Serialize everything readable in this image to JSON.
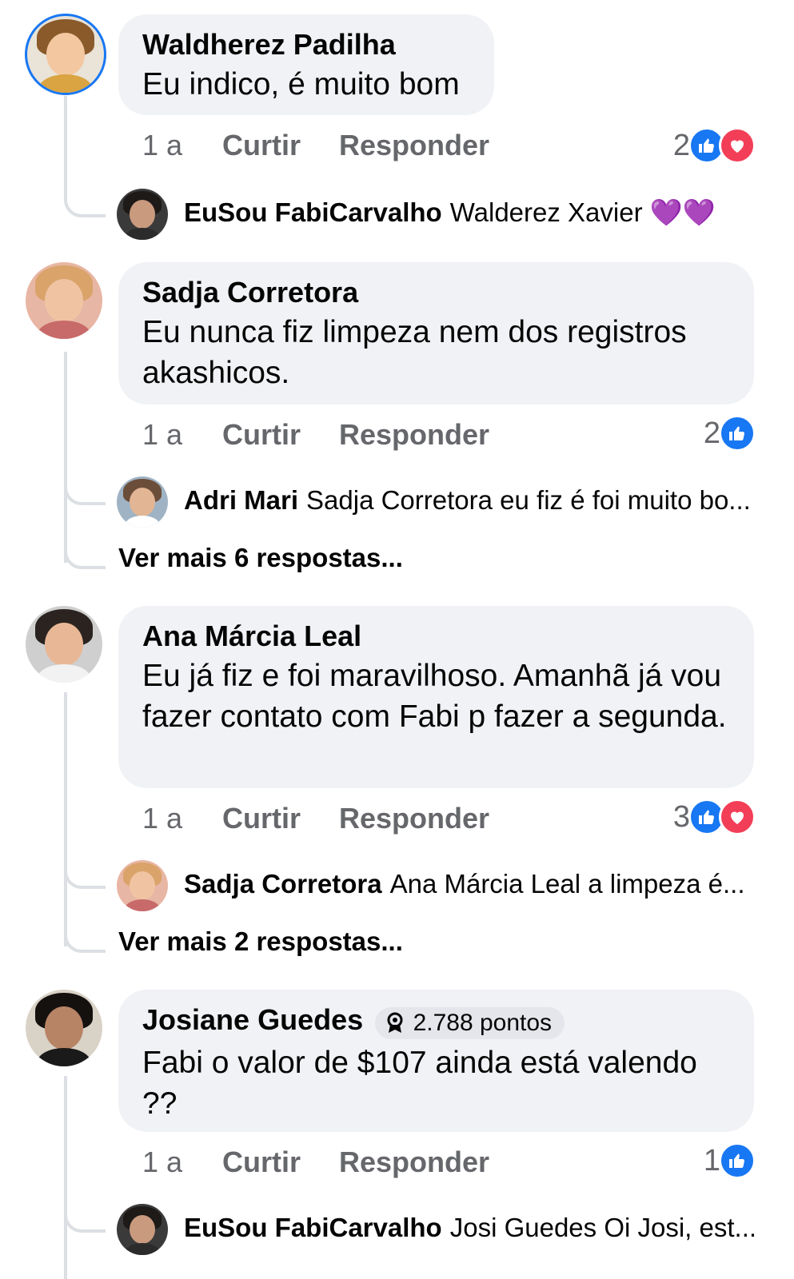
{
  "comments": [
    {
      "name": "Waldherez Padilha",
      "text": "Eu indico, é muito bom",
      "time": "1 a",
      "like_label": "Curtir",
      "reply_label": "Responder",
      "reaction_count": "2",
      "reactions": [
        "like-icon",
        "love-icon"
      ],
      "reply": {
        "name": "EuSou FabiCarvalho",
        "text": "Walderez Xavier 💜💜"
      }
    },
    {
      "name": "Sadja Corretora",
      "text": "Eu nunca fiz limpeza nem dos registros akashicos.",
      "time": "1 a",
      "like_label": "Curtir",
      "reply_label": "Responder",
      "reaction_count": "2",
      "reactions": [
        "like-icon"
      ],
      "reply": {
        "name": "Adri Mari",
        "text": "Sadja Corretora eu fiz é foi muito bo..."
      },
      "more_replies": "Ver mais 6 respostas..."
    },
    {
      "name": "Ana Márcia Leal",
      "text": "Eu já fiz e foi maravilhoso. Amanhã já vou fazer contato com Fabi p fazer a segunda.",
      "time": "1 a",
      "like_label": "Curtir",
      "reply_label": "Responder",
      "reaction_count": "3",
      "reactions": [
        "like-icon",
        "love-icon"
      ],
      "reply": {
        "name": "Sadja Corretora",
        "text": "Ana Márcia Leal  a limpeza é..."
      },
      "more_replies": "Ver mais 2 respostas..."
    },
    {
      "name": "Josiane Guedes",
      "badge": "2.788 pontos",
      "text": "Fabi o valor de $107 ainda está valendo ??",
      "time": "1 a",
      "like_label": "Curtir",
      "reply_label": "Responder",
      "reaction_count": "1",
      "reactions": [
        "like-icon"
      ],
      "reply": {
        "name": "EuSou FabiCarvalho",
        "text": "Josi Guedes  Oi Josi, est..."
      }
    }
  ],
  "colors": {
    "bubble": "#f0f2f5",
    "like": "#1877f2",
    "love": "#f33e58",
    "muted_text": "#65676b",
    "thread_line": "#dcdfe3"
  }
}
